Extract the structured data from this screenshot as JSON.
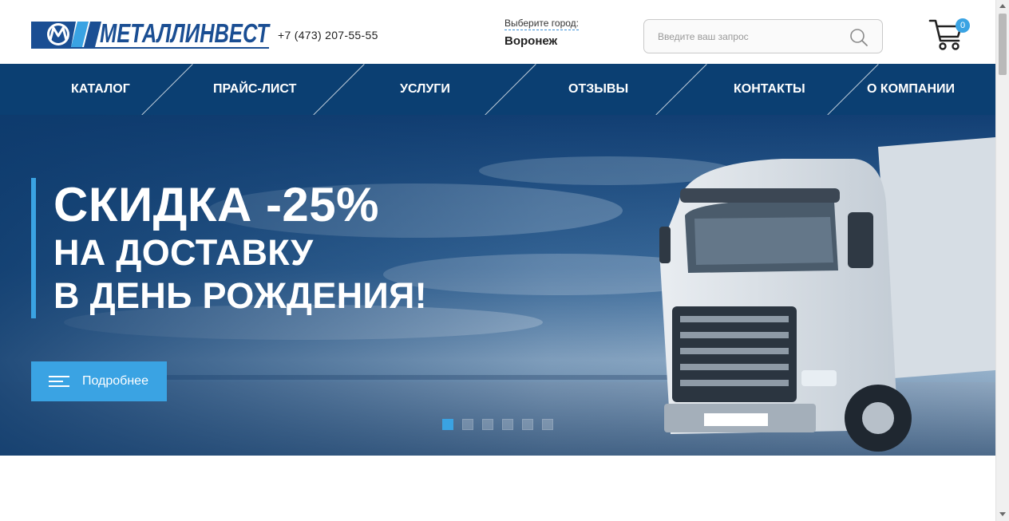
{
  "header": {
    "logo_text": "МЕТАЛЛИНВЕСТ",
    "phone": "+7 (473) 207-55-55",
    "city_label": "Выберите город:",
    "city_name": "Воронеж",
    "search_placeholder": "Введите ваш запрос",
    "cart_count": "0"
  },
  "nav": {
    "items": [
      {
        "label": "Каталог"
      },
      {
        "label": "Прайс-лист"
      },
      {
        "label": "Услуги"
      },
      {
        "label": "Отзывы"
      },
      {
        "label": "Контакты"
      },
      {
        "label": "О компании"
      }
    ]
  },
  "hero": {
    "line1": "Скидка -25%",
    "line2": "на доставку",
    "line3": "в день рождения!",
    "button_label": "Подробнее",
    "slides_total": 6,
    "active_slide": 1
  },
  "colors": {
    "brand_dark_blue": "#0b3f72",
    "accent_blue": "#3aa3e3",
    "logo_blue": "#1a4e93"
  },
  "icons": {
    "search": "search-icon",
    "cart": "cart-icon",
    "menu_lines": "menu-lines-icon",
    "logo": "metallinvest-logo"
  }
}
